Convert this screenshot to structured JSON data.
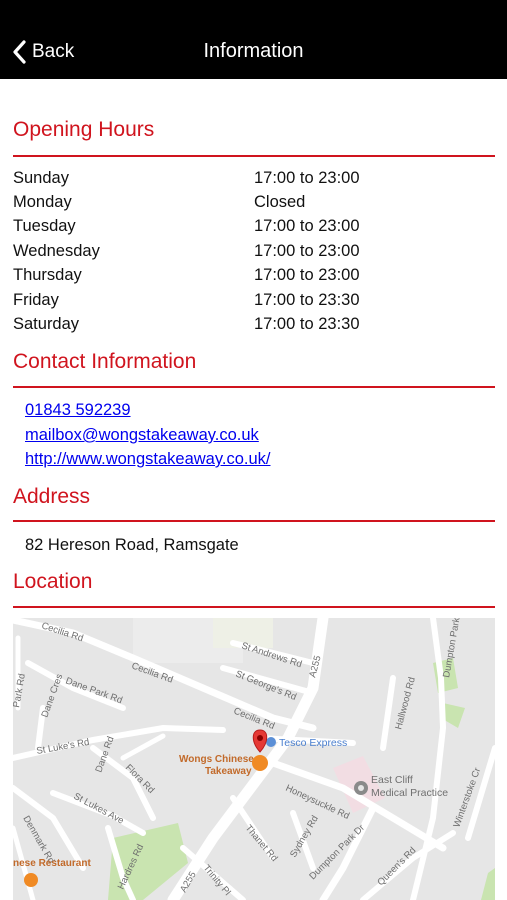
{
  "header": {
    "back_label": "Back",
    "title": "Information"
  },
  "opening_hours": {
    "title": "Opening Hours",
    "rows": [
      {
        "day": "Sunday",
        "time": "17:00 to 23:00"
      },
      {
        "day": "Monday",
        "time": "Closed"
      },
      {
        "day": "Tuesday",
        "time": "17:00 to 23:00"
      },
      {
        "day": "Wednesday",
        "time": "17:00 to 23:00"
      },
      {
        "day": "Thursday",
        "time": "17:00 to 23:00"
      },
      {
        "day": "Friday",
        "time": "17:00 to 23:30"
      },
      {
        "day": "Saturday",
        "time": "17:00 to 23:30"
      }
    ]
  },
  "contact": {
    "title": "Contact Information",
    "phone": "01843 592239",
    "email": "mailbox@wongstakeaway.co.uk",
    "website": "http://www.wongstakeaway.co.uk/"
  },
  "address": {
    "title": "Address",
    "text": "82 Hereson Road, Ramsgate"
  },
  "location": {
    "title": "Location",
    "map": {
      "pois": {
        "main": "Wongs Chinese Takeaway",
        "main_line1": "Wongs Chinese",
        "main_line2": "Takeaway",
        "tesco": "Tesco Express",
        "medical_line1": "East Cliff",
        "medical_line2": "Medical Practice",
        "restaurant": "nese Restaurant"
      },
      "roads": {
        "cecilia1": "Cecilia Rd",
        "cecilia2": "Cecilia Rd",
        "cecilia3": "Cecilia Rd",
        "st_andrews": "St Andrews Rd",
        "st_georges": "St George's Rd",
        "dane_park": "Dane Park Rd",
        "dane_cres": "Dane Cres",
        "st_lukes_rd": "St Luke's Rd",
        "st_lukes_ave": "St Lukes Ave",
        "flora": "Flora Rd",
        "dane_rd": "Dane Rd",
        "a255_top": "A255",
        "a255_bottom": "A255",
        "honeysuckle": "Honeysuckle Rd",
        "thanet": "Thanet Rd",
        "sydney": "Sydney Rd",
        "dumpton_park_dr": "Dumpton Park Dr",
        "dumpton_park_top": "Dumpton Park",
        "hallwood": "Hallwood Rd",
        "denmark": "Denmark Rd",
        "hardres": "Hardres Rd",
        "trinity": "Trinity Pl",
        "queens": "Queen's Rd",
        "winterstoke": "Winterstoke Cr",
        "park": "Park Rd"
      }
    }
  },
  "colors": {
    "accent": "#d0141e",
    "link": "#0000ee",
    "navbar": "#000000"
  }
}
